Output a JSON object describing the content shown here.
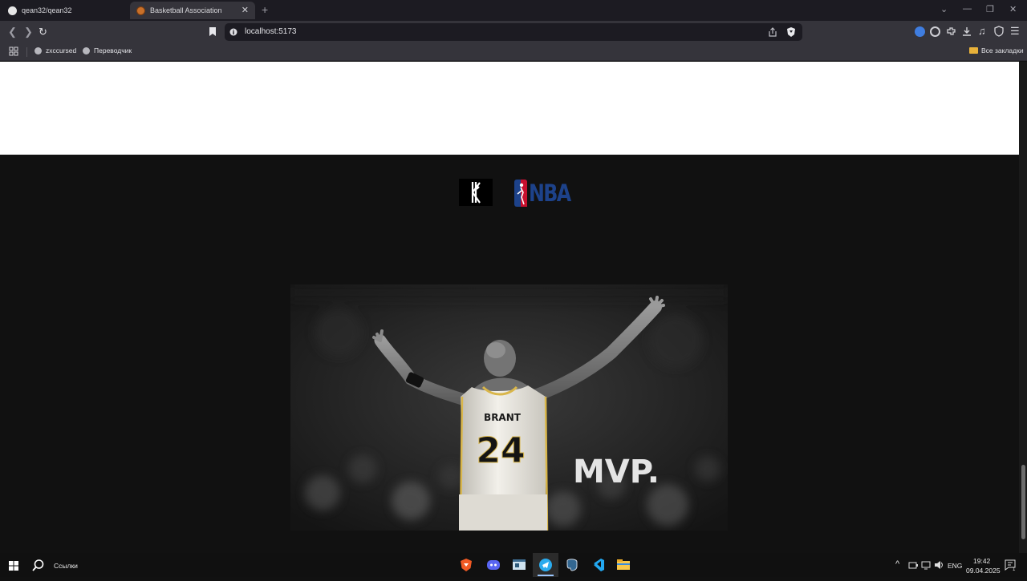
{
  "browser": {
    "tabs": [
      {
        "label": "qean32/qean32",
        "icon": "github-icon"
      },
      {
        "label": "Basketball Association",
        "icon": "basketball-icon"
      }
    ],
    "new_tab": "+",
    "url": "localhost:5173",
    "bookmarks": [
      {
        "label": "zxccursed",
        "icon": "globe-icon"
      },
      {
        "label": "Переводчик",
        "icon": "globe-icon"
      }
    ],
    "all_bookmarks": "Все закладки"
  },
  "page": {
    "hero_caption": "MVP.",
    "jersey_name": "BRANT",
    "jersey_number": "24",
    "logo_nba": "NBA"
  },
  "taskbar": {
    "search_label": "Ссылки",
    "lang": "ENG",
    "time": "19:42",
    "date": "09.04.2025",
    "notif_count": "1"
  },
  "colors": {
    "nba_blue": "#1d428a",
    "nba_red": "#c8102e",
    "page_bg": "#111111"
  }
}
